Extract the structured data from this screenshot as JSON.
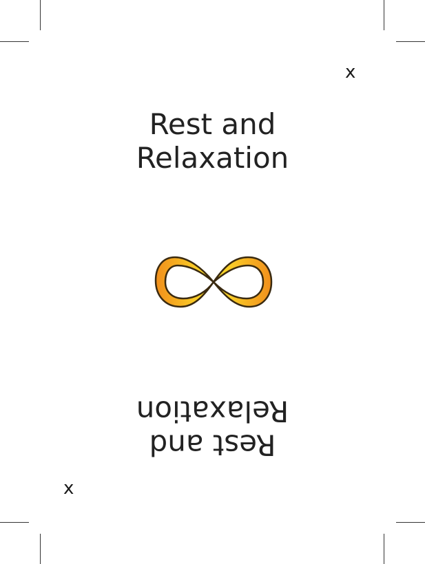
{
  "card": {
    "title_line1": "Rest and",
    "title_line2": "Relaxation",
    "corner_mark": "x",
    "symbol_icon": "infinity-icon"
  },
  "colors": {
    "symbol_gradient_start": "#f18f1c",
    "symbol_gradient_mid": "#f7c01e",
    "symbol_gradient_end": "#fde52b",
    "symbol_outline": "#3a2a10",
    "crop_marks": "#333333"
  }
}
